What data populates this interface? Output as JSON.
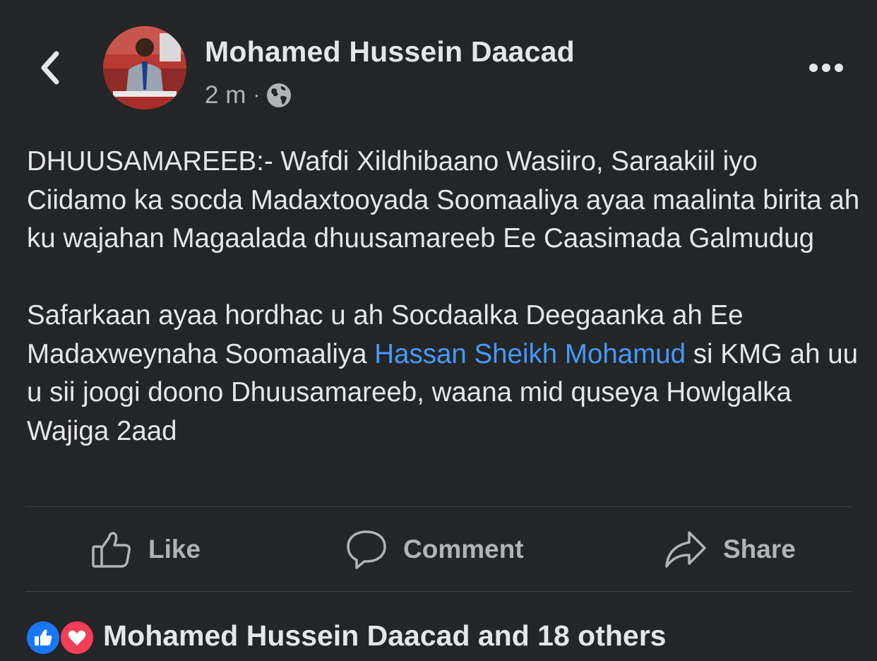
{
  "header": {
    "author_name": "Mohamed Hussein Daacad",
    "timestamp": "2 m",
    "separator": "·",
    "audience_icon": "globe-icon",
    "back_icon": "chevron-left-icon",
    "more_icon": "more-horizontal-icon"
  },
  "post": {
    "paragraph1": "DHUUSAMAREEB:- Wafdi Xildhibaano Wasiiro, Saraakiil iyo Ciidamo ka socda Madaxtooyada Soomaaliya ayaa maalinta birita ah ku wajahan Magaalada dhuusamareeb Ee Caasimada Galmudug",
    "paragraph2_before": "Safarkaan ayaa hordhac u ah Socdaalka Deegaanka ah Ee Madaxweynaha Soomaaliya ",
    "paragraph2_mention": "Hassan Sheikh Mohamud",
    "paragraph2_after": " si KMG ah uu u sii joogi doono Dhuusamareeb, waana mid quseya Howlgalka Wajiga 2aad"
  },
  "actions": {
    "like_label": "Like",
    "comment_label": "Comment",
    "share_label": "Share"
  },
  "reactions": {
    "summary": "Mohamed Hussein Daacad and 18 others",
    "icons": [
      "like-reaction-icon",
      "love-reaction-icon"
    ]
  },
  "colors": {
    "background": "#242526",
    "text_primary": "#e4e6eb",
    "text_secondary": "#b0b3b8",
    "mention": "#4599ff",
    "like_blue": "#1877f2",
    "love_red": "#f33e58",
    "divider": "#3e4042"
  }
}
